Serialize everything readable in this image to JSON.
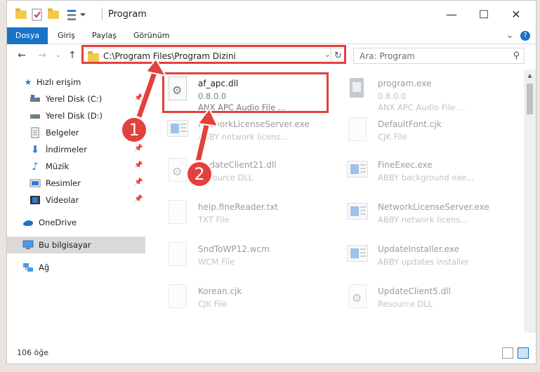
{
  "window": {
    "title": "Program"
  },
  "ribbon": {
    "tabs": [
      "Dosya",
      "Giriş",
      "Paylaş",
      "Görünüm"
    ],
    "help": "?"
  },
  "navbar": {
    "address": "C:\\Program Files\\Program Dizini",
    "search_placeholder": "Ara: Program"
  },
  "sidebar": {
    "items": [
      {
        "label": "Hızlı erişim",
        "icon": "star-icon",
        "pinned": false
      },
      {
        "label": "Yerel Disk (C:)",
        "icon": "drive-icon",
        "pinned": true
      },
      {
        "label": "Yerel Disk (D:)",
        "icon": "drive-icon",
        "pinned": true
      },
      {
        "label": "Belgeler",
        "icon": "documents-icon",
        "pinned": true
      },
      {
        "label": "İndirmeler",
        "icon": "download-icon",
        "pinned": true
      },
      {
        "label": "Müzik",
        "icon": "music-icon",
        "pinned": true
      },
      {
        "label": "Resimler",
        "icon": "pictures-icon",
        "pinned": true
      },
      {
        "label": "Videolar",
        "icon": "videos-icon",
        "pinned": true
      },
      {
        "label": "OneDrive",
        "icon": "cloud-icon",
        "pinned": false
      },
      {
        "label": "Bu bilgisayar",
        "icon": "computer-icon",
        "pinned": false,
        "selected": true
      },
      {
        "label": "Ağ",
        "icon": "network-icon",
        "pinned": false
      }
    ]
  },
  "files": [
    {
      "name": "af_apc.dll",
      "line1": "0.8.0.0",
      "line2": "ANX APC Audio File ...",
      "icon": "dll-file-icon"
    },
    {
      "name": "program.exe",
      "line1": "0.8.0.0",
      "line2": "ANX APC Audio File ...",
      "icon": "setup-file-icon"
    },
    {
      "name": "NetworkLicenseServer.exe",
      "line1": "ABBY network licens...",
      "icon": "exe-file-icon"
    },
    {
      "name": "DefaultFont.cjk",
      "line1": "CJK File",
      "icon": "blank-file-icon"
    },
    {
      "name": "UpdateClient21.dll",
      "line1": "Resource DLL",
      "icon": "dll-file-icon"
    },
    {
      "name": "FineExec.exe",
      "line1": "ABBY background exe...",
      "icon": "exe-file-icon"
    },
    {
      "name": "help.fineReader.txt",
      "line1": "TXT File",
      "icon": "blank-file-icon"
    },
    {
      "name": "NetworkLicenseServer.exe",
      "line1": "ABBY network licens...",
      "icon": "exe-file-icon"
    },
    {
      "name": "SndToWP12.wcm",
      "line1": "WCM File",
      "icon": "blank-file-icon"
    },
    {
      "name": "UpdateInstaller.exe",
      "line1": "ABBY updates installer",
      "icon": "exe-file-icon"
    },
    {
      "name": "Korean.cjk",
      "line1": "CJK File",
      "icon": "blank-file-icon"
    },
    {
      "name": "UpdateClient5.dll",
      "line1": "Resource DLL",
      "icon": "dll-file-icon"
    }
  ],
  "status": {
    "count": "106 öğe"
  },
  "callouts": [
    "1",
    "2"
  ],
  "colors": {
    "accent": "#1a73c6",
    "highlight": "#e2413d"
  }
}
